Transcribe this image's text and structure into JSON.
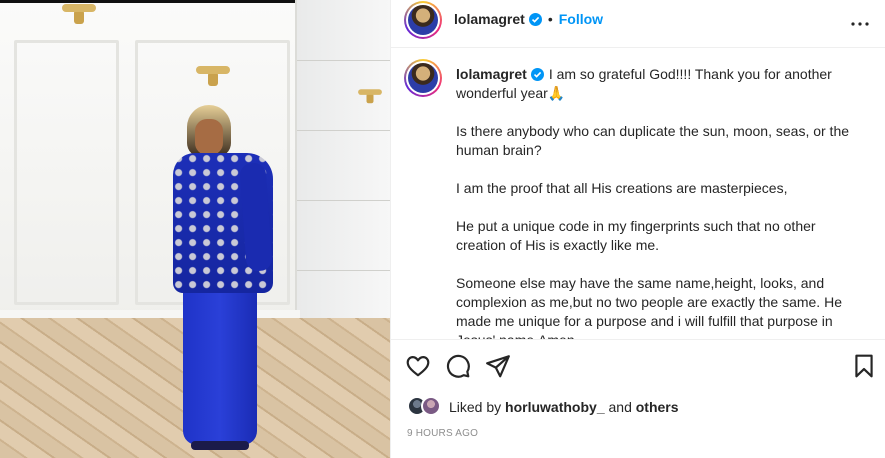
{
  "post": {
    "username": "lolamagret",
    "follow_label": "Follow",
    "separator": "•",
    "caption_paragraphs": [
      "I am so grateful God!!!! Thank you for another wonderful year🙏",
      "Is there anybody who can duplicate the sun, moon, seas, or the human brain?",
      "I am the proof that all His creations are masterpieces,",
      "He put a unique code in my fingerprints such that no other creation of His is exactly like me.",
      "Someone else may have the same name,height, looks, and complexion as me,but no two people are exactly the same. He made me unique for a purpose and i will fulfill that purpose in Jesus' name.Amen"
    ],
    "likes": {
      "prefix": "Liked by",
      "user": "horluwathoby_",
      "connector": "and",
      "others": "others"
    },
    "timestamp": "9 HOURS AGO"
  },
  "icons": {
    "verified": "verified-badge-icon",
    "more": "more-options-icon",
    "like": "heart-icon",
    "comment": "comment-icon",
    "share": "share-icon",
    "save": "bookmark-icon"
  },
  "colors": {
    "accent": "#0095f6",
    "text": "#262626",
    "muted": "#8e8e8e",
    "divider": "#efefef"
  }
}
